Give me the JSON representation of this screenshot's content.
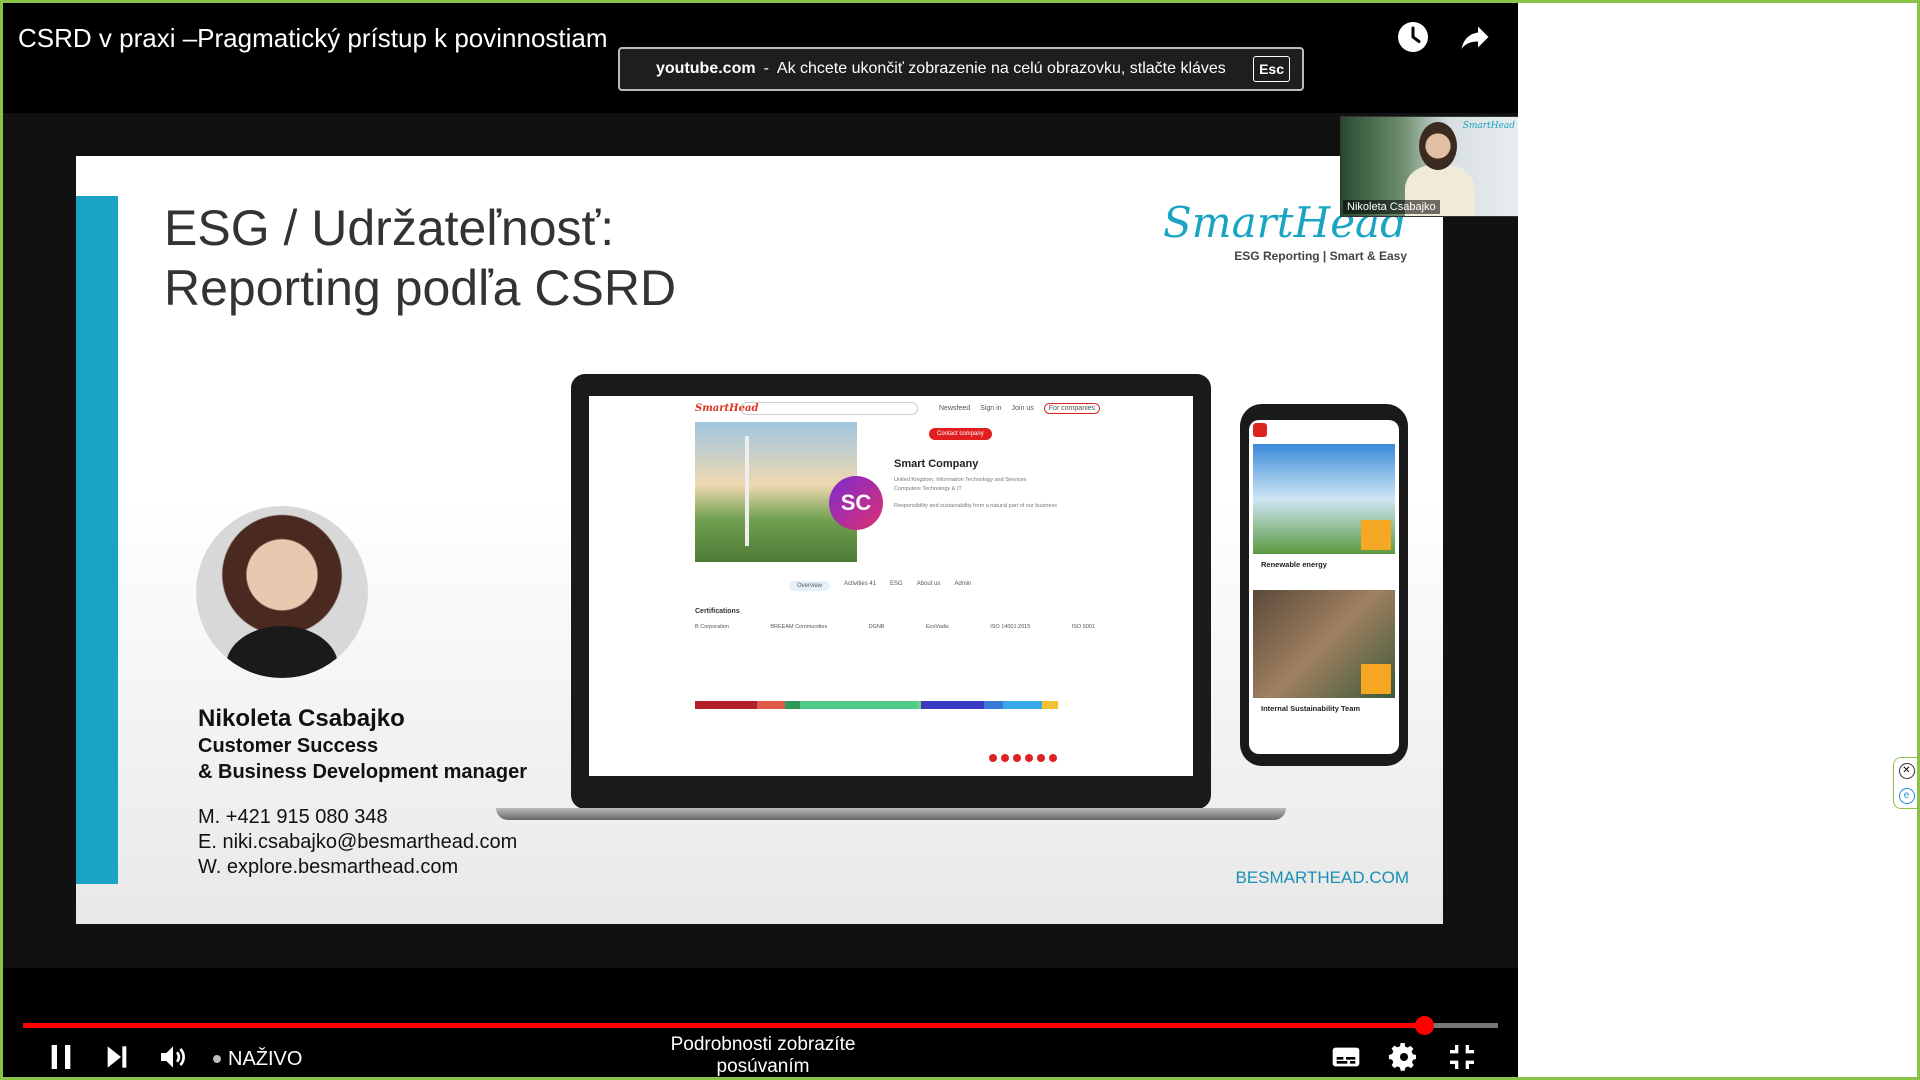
{
  "video": {
    "title": "CSRD v praxi –Pragmatický prístup k povinnostiam",
    "progress_fraction": 0.95
  },
  "fullscreen_notice": {
    "domain": "youtube.com",
    "separator": "-",
    "message": "Ak chcete ukončiť zobrazenie na celú obrazovku, stlačte kláves",
    "key": "Esc"
  },
  "slide": {
    "title_line1": "ESG / Udržateľnosť:",
    "title_line2": "Reporting podľa CSRD",
    "brand_logo": "SmartHead",
    "brand_tagline": "ESG Reporting | Smart & Easy",
    "person_name": "Nikoleta Csabajko",
    "role_line1": "Customer Success",
    "role_line2": "& Business Development manager",
    "phone": "M. +421 915 080 348",
    "email": "E. niki.csabajko@besmarthead.com",
    "web": "W. explore.besmarthead.com",
    "footer_url": "BESMARTHEAD.COM",
    "laptop": {
      "logo": "SmartHead",
      "nav": [
        "Newsfeed",
        "Sign in",
        "Join us",
        "For companies"
      ],
      "company": "Smart Company",
      "badge": "SC",
      "contact_button": "Contact company",
      "desc_line1": "United Kingdom, Information Technology and Services",
      "desc_line2": "Computers Technology & IT",
      "desc_line3": "Responsibility and sustainability form a natural part of our business",
      "tabs": [
        "Overview",
        "Activities 41",
        "ESG",
        "About us",
        "Admin"
      ],
      "certifications_title": "Certifications",
      "certs": [
        "B Corporation",
        "BREEAM Communities",
        "DGNB",
        "EcoVadis",
        "ISO 14001:2015",
        "ISO 5001"
      ],
      "bar_colors": [
        "#b3202a",
        "#e05a4a",
        "#2d9a5a",
        "#4ec98a",
        "#6ad08e",
        "#3a3ac0",
        "#3a7ad8",
        "#3aa8e8",
        "#f5c230"
      ],
      "bar_fractions": [
        0.16,
        0.07,
        0.04,
        0.3,
        0.01,
        0.16,
        0.05,
        0.1,
        0.04
      ]
    },
    "phone_mock": {
      "card1_label": "Renewable energy",
      "card2_label": "Internal Sustainability Team"
    }
  },
  "pip": {
    "name": "Nikoleta Csabajko",
    "brand": "SmartHead"
  },
  "controls": {
    "live_label": "NAŽIVO",
    "scroll_hint": "Podrobnosti zobrazíte posúvaním",
    "scroll_chevron": "⌄"
  },
  "icons": {
    "watch_later": "clock-icon",
    "share": "share-icon",
    "pause": "pause-icon",
    "next": "skip-next-icon",
    "volume": "volume-icon",
    "subtitles": "subtitles-icon",
    "settings": "gear-icon",
    "exit_fullscreen": "exit-fullscreen-icon"
  },
  "colors": {
    "progress": "#ff0000",
    "brand_teal": "#1aa4c4",
    "window_border": "#8bc34a"
  }
}
